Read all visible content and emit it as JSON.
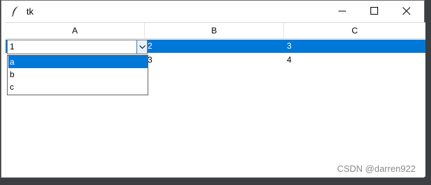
{
  "window": {
    "title": "tk"
  },
  "table": {
    "headers": [
      "A",
      "B",
      "C"
    ],
    "rows": [
      [
        "1",
        "2",
        "3"
      ],
      [
        "",
        "3",
        "4"
      ]
    ]
  },
  "combobox": {
    "value": "1",
    "options": [
      "a",
      "b",
      "c"
    ]
  },
  "watermark": "CSDN @darren922",
  "colors": {
    "selection": "#0078d7"
  }
}
